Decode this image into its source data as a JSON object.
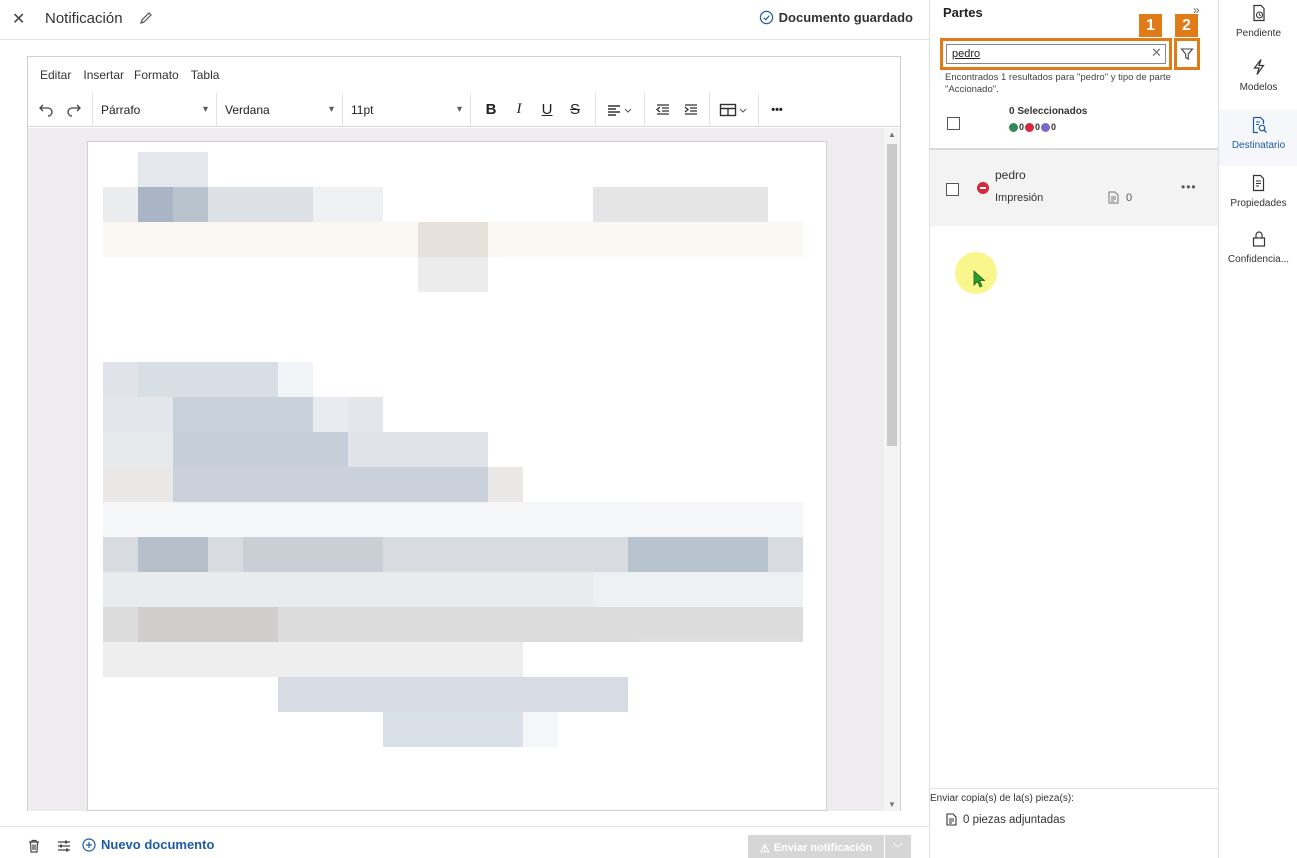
{
  "header": {
    "title": "Notificación",
    "saved_status": "Documento guardado"
  },
  "editor": {
    "menu": [
      "Editar",
      "Insertar",
      "Formato",
      "Tabla"
    ],
    "paragraph_style": "Párrafo",
    "font_family": "Verdana",
    "font_size": "11pt",
    "bold": "B",
    "italic": "I",
    "underline": "U",
    "strike": "S",
    "more": "•••"
  },
  "footer": {
    "new_document": "Nuevo documento",
    "send_notification": "Enviar notificación"
  },
  "parties_panel": {
    "title": "Partes",
    "search_value": "pedro",
    "callout_1": "1",
    "callout_2": "2",
    "result_info": "Encontrados 1 resultados para \"pedro\" y tipo de parte \"Accionado\".",
    "selected_count": "0 Seleccionados",
    "status_counts": [
      "0",
      "0",
      "0"
    ],
    "party": {
      "name": "pedro",
      "role": "Impresión",
      "doc_count": "0"
    },
    "copy_label": "Enviar copia(s) de la(s) pieza(s):",
    "attached_pieces": "0 piezas adjuntadas"
  },
  "nav_rail": {
    "items": [
      {
        "label": "Pendiente",
        "icon": "pending-doc-icon"
      },
      {
        "label": "Modelos",
        "icon": "models-icon"
      },
      {
        "label": "Destinatario",
        "icon": "recipient-icon",
        "active": true
      },
      {
        "label": "Propiedades",
        "icon": "properties-icon"
      },
      {
        "label": "Confidencia...",
        "icon": "lock-icon"
      }
    ]
  },
  "colors": {
    "accent": "#1f5aa6",
    "callout": "#e07b17",
    "status_green": "#2e8b57",
    "status_red": "#d4293c",
    "status_purple": "#7b68c8",
    "cursor_highlight": "#f8f678"
  }
}
